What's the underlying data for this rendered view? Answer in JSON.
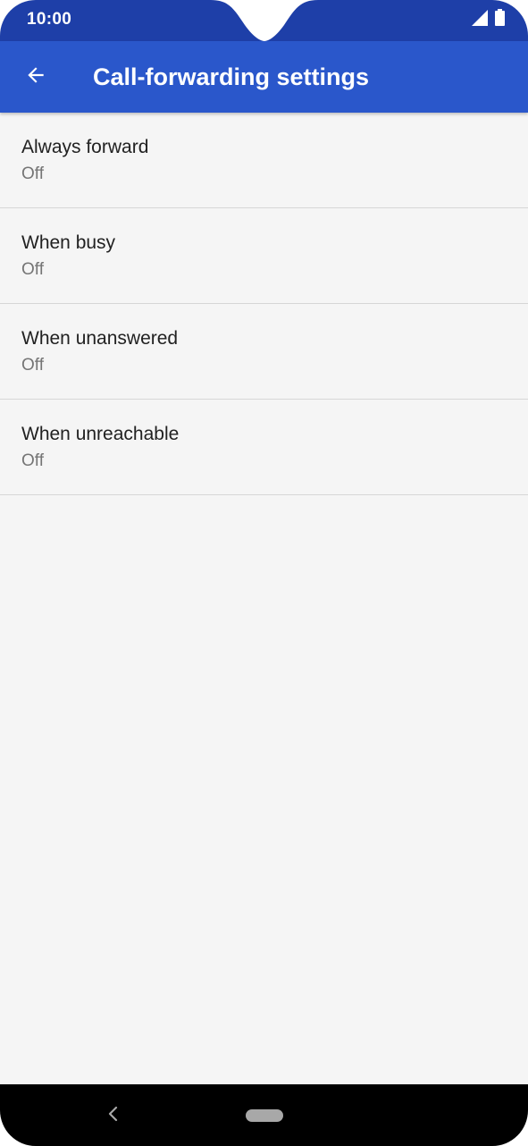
{
  "status_bar": {
    "time": "10:00",
    "icons": [
      "signal-icon",
      "battery-icon"
    ]
  },
  "app_bar": {
    "back_icon": "arrow-left-icon",
    "title": "Call-forwarding settings"
  },
  "settings": {
    "items": [
      {
        "title": "Always forward",
        "summary": "Off"
      },
      {
        "title": "When busy",
        "summary": "Off"
      },
      {
        "title": "When unanswered",
        "summary": "Off"
      },
      {
        "title": "When unreachable",
        "summary": "Off"
      }
    ]
  },
  "nav_bar": {
    "back_icon": "chevron-left-icon",
    "home_icon": "home-pill-icon"
  },
  "colors": {
    "status_bar": "#1e3fa8",
    "app_bar": "#2a57cb",
    "background": "#f5f5f5",
    "divider": "#d6d6d6",
    "primary_text": "#212121",
    "secondary_text": "#757575"
  }
}
